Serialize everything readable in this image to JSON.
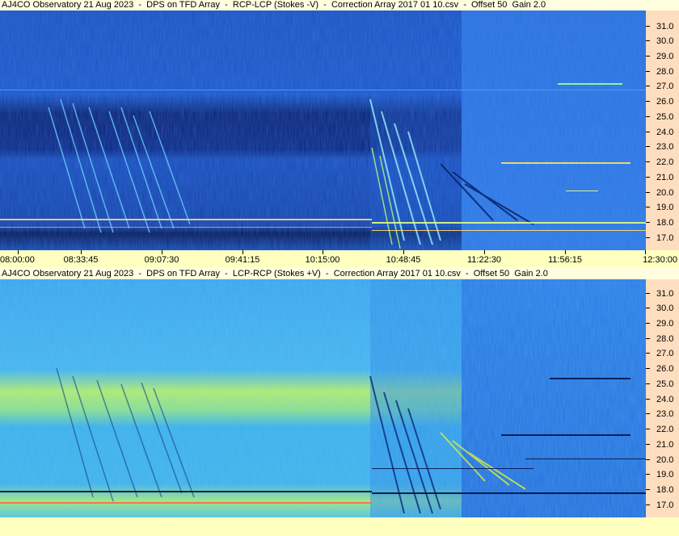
{
  "panels": [
    {
      "title": "AJ4CO Observatory 21 Aug 2023  -  DPS on TFD Array  -  RCP-LCP (Stokes -V)  -  Correction Array 2017 01 10.csv  -  Offset 50  Gain 2.0",
      "colors": {
        "base": "#1f5fcc",
        "dark_band": "#0a1f6e",
        "right_region": "#2a72e0",
        "burst": "#7fe8ff"
      }
    },
    {
      "title": "AJ4CO Observatory 21 Aug 2023  -  DPS on TFD Array  -  LCP-RCP (Stokes +V)  -  Correction Array 2017 01 10.csv  -  Offset 50  Gain 2.0",
      "colors": {
        "base": "#3aa6ee",
        "bright_band": "#b9f05a",
        "right_region": "#2a7de6",
        "burst": "#0a2a8a"
      }
    }
  ],
  "y_ticks": [
    "31.0",
    "30.0",
    "29.0",
    "28.0",
    "27.0",
    "26.0",
    "25.0",
    "24.0",
    "23.0",
    "22.0",
    "21.0",
    "20.0",
    "19.0",
    "18.0",
    "17.0"
  ],
  "x_ticks": [
    "08:00:00",
    "08:33:45",
    "09:07:30",
    "09:41:15",
    "10:15:00",
    "10:48:45",
    "11:22:30",
    "11:56:15",
    "12:30:00"
  ]
}
